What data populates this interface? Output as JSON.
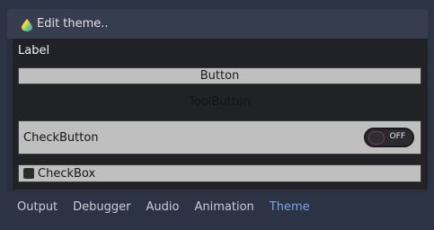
{
  "window": {
    "title": "Edit theme..",
    "icon": "theme-droplet-icon"
  },
  "preview": {
    "label_text": "Label",
    "button_text": "Button",
    "toolbutton_text": "ToolButton",
    "checkbutton": {
      "label": "CheckButton",
      "switch_state": "OFF"
    },
    "checkbox": {
      "label": "CheckBox",
      "checked": false
    }
  },
  "bottom_tabs": [
    {
      "label": "Output",
      "active": false
    },
    {
      "label": "Debugger",
      "active": false
    },
    {
      "label": "Audio",
      "active": false
    },
    {
      "label": "Animation",
      "active": false
    },
    {
      "label": "Theme",
      "active": true
    }
  ],
  "colors": {
    "active_tab": "#74a6e4",
    "background": "#2c3344",
    "panel": "#202226",
    "control": "#bfbfbf"
  }
}
